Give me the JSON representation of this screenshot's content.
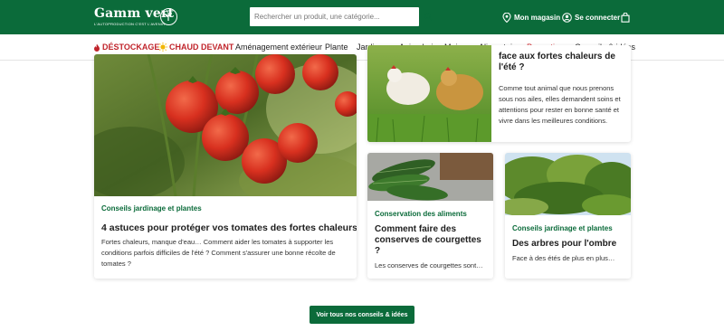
{
  "header": {
    "logo_text": "Gamm vert",
    "logo_tagline": "L'AUTOPRODUCTION C'EST L'AVENIR",
    "search_placeholder": "Rechercher un produit, une catégorie...",
    "store_label": "Mon magasin",
    "login_label": "Se connecter",
    "brand_color": "#0b6b3a"
  },
  "nav": {
    "items": [
      {
        "label": "DÉSTOCKAGE",
        "icon": "fire-icon"
      },
      {
        "label": "CHAUD DEVANT",
        "icon": "sun-icon"
      },
      {
        "label": "Aménagement extérieur"
      },
      {
        "label": "Plante"
      },
      {
        "label": "Jardinage"
      },
      {
        "label": "Animalerie"
      },
      {
        "label": "Maison"
      },
      {
        "label": "Alimentaire"
      },
      {
        "label": "Promotions"
      },
      {
        "label": "Conseils & idées"
      }
    ]
  },
  "articles": {
    "tomatoes": {
      "category": "Conseils jardinage et plantes",
      "title": "4 astuces pour protéger vos tomates des fortes chaleurs",
      "description": "Fortes chaleurs, manque d'eau… Comment aider les tomates à supporter les conditions parfois difficiles de l'été ? Comment s'assurer une bonne récolte de tomates ?"
    },
    "hens": {
      "title_partial": "face aux fortes chaleurs de l'été ?",
      "description": "Comme tout animal que nous prenons sous nos ailes, elles demandent soins et attentions pour rester en bonne santé et vivre dans les meilleures conditions."
    },
    "courgettes": {
      "category": "Conservation des aliments",
      "title": "Comment faire des conserves de courgettes ?",
      "description": "Les conserves de courgettes sont…"
    },
    "trees": {
      "category": "Conseils jardinage et plantes",
      "title": "Des arbres pour l'ombre",
      "description": "Face à des étés de plus en plus…"
    }
  },
  "cta": {
    "label": "Voir tous nos conseils & idées"
  }
}
